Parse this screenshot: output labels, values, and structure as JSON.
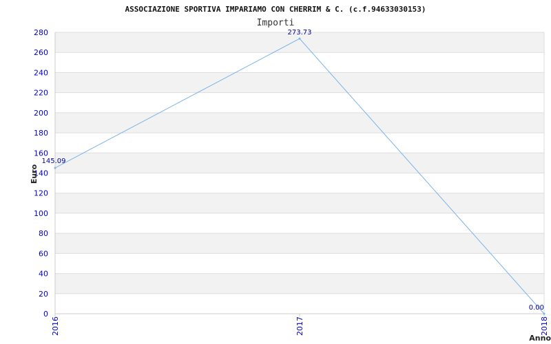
{
  "chart_data": {
    "type": "line",
    "title": "ASSOCIAZIONE SPORTIVA IMPARIAMO CON CHERRIM & C. (c.f.94633030153)",
    "subtitle": "Importi",
    "xlabel": "Anno",
    "ylabel": "Euro",
    "categories": [
      "2016",
      "2017",
      "2018"
    ],
    "series": [
      {
        "values": [
          145.09,
          273.73,
          0.0
        ]
      }
    ],
    "data_labels": [
      "145.09",
      "273.73",
      "0.00"
    ],
    "ylim": [
      0,
      280
    ],
    "yticks": [
      0,
      20,
      40,
      60,
      80,
      100,
      120,
      140,
      160,
      180,
      200,
      220,
      240,
      260,
      280
    ],
    "grid": true,
    "colors": {
      "line": "#7ab3ea",
      "band": "#f2f2f2",
      "grid": "#dddddd",
      "tick": "#0000cc",
      "data_label": "#000099"
    }
  }
}
